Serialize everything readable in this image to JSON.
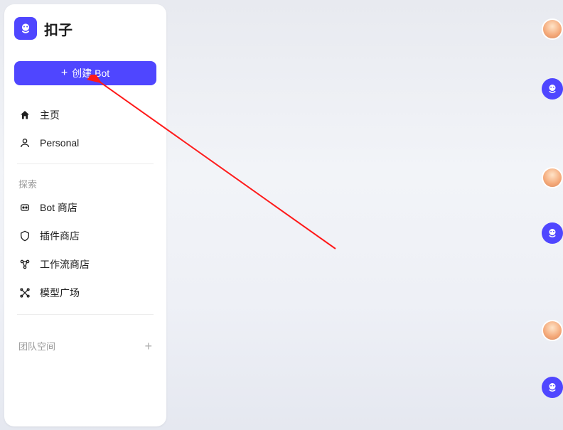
{
  "brand": {
    "title": "扣子"
  },
  "create_button": {
    "label": "创建 Bot"
  },
  "nav": {
    "home": {
      "label": "主页"
    },
    "personal": {
      "label": "Personal"
    }
  },
  "explore": {
    "section_label": "探索",
    "items": [
      {
        "id": "bot-store",
        "label": "Bot 商店"
      },
      {
        "id": "plugin-store",
        "label": "插件商店"
      },
      {
        "id": "workflow-store",
        "label": "工作流商店"
      },
      {
        "id": "model-square",
        "label": "模型广场"
      }
    ]
  },
  "team": {
    "section_label": "团队空间"
  },
  "colors": {
    "primary": "#4f46ff"
  }
}
